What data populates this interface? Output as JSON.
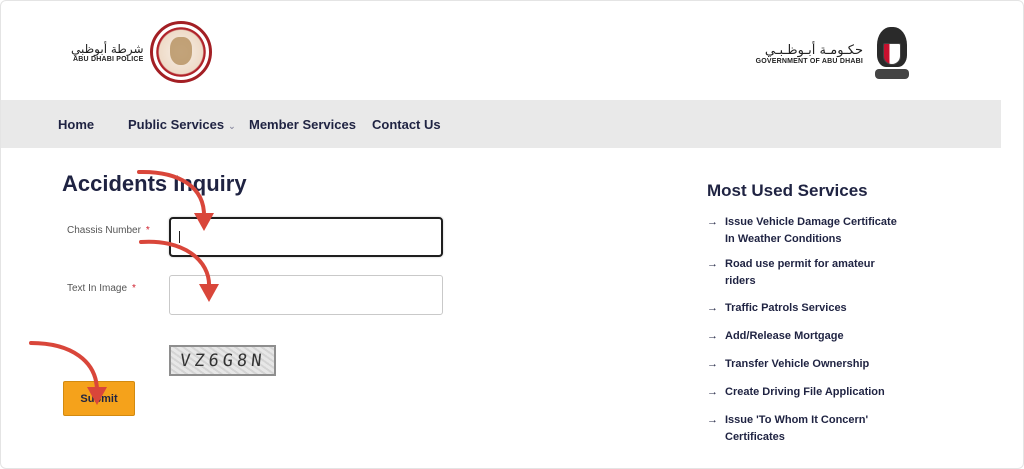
{
  "header": {
    "left_logo": {
      "arabic": "شرطة أبوظبي",
      "english": "ABU DHABI POLICE"
    },
    "right_logo": {
      "arabic": "حكـومـة أبـوظـبـي",
      "english": "GOVERNMENT OF ABU DHABI"
    }
  },
  "nav": {
    "items": [
      {
        "label": "Home"
      },
      {
        "label": "Public Services",
        "has_dropdown": true,
        "chevron": "⌄"
      },
      {
        "label": "Member Services"
      },
      {
        "label": "Contact Us"
      }
    ]
  },
  "form": {
    "title": "Accidents Inquiry",
    "chassis_label": "Chassis Number",
    "text_image_label": "Text In Image",
    "required_mark": "*",
    "chassis_value": "",
    "text_image_value": "",
    "captcha_text": "VZ6G8N",
    "submit_label": "Submit"
  },
  "sidebar": {
    "title": "Most Used Services",
    "arrow_glyph": "→",
    "items": [
      {
        "label": "Issue Vehicle Damage Certificate\nIn Weather Conditions"
      },
      {
        "label": "Road use permit for amateur\nriders"
      },
      {
        "label": "Traffic Patrols Services"
      },
      {
        "label": "Add/Release Mortgage"
      },
      {
        "label": "Transfer Vehicle Ownership"
      },
      {
        "label": "Create Driving File Application"
      },
      {
        "label": "Issue 'To Whom It Concern'\nCertificates"
      }
    ]
  },
  "colors": {
    "navy": "#1f2342",
    "nav_bg": "#e9e9e9",
    "submit_bg": "#f5a21b",
    "required": "#d0202e",
    "annotation_arrow": "#d9463a"
  }
}
